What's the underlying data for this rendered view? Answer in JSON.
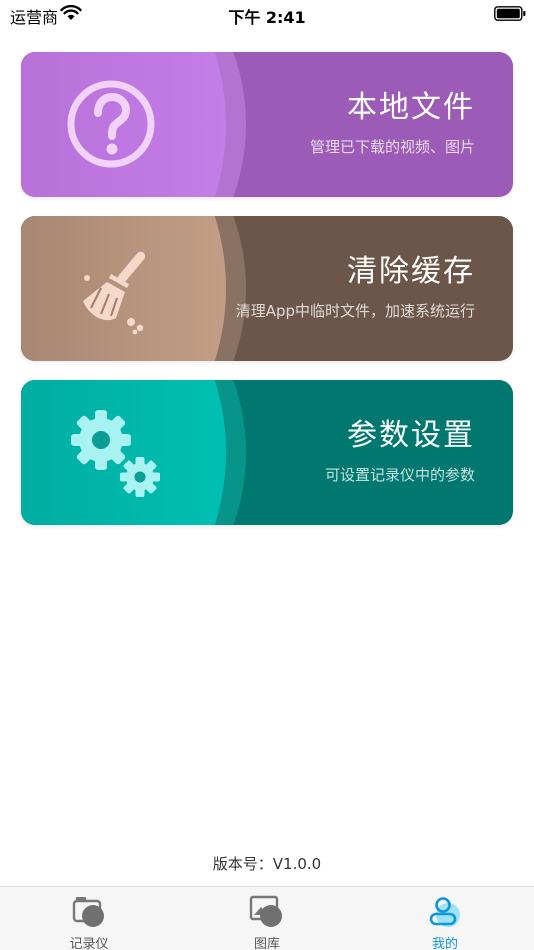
{
  "status_bar": {
    "carrier": "运营商",
    "time": "下午 2:41"
  },
  "cards": [
    {
      "title": "本地文件",
      "subtitle": "管理已下载的视频、图片",
      "icon": "question-circle-icon",
      "color": "#9c5bb6"
    },
    {
      "title": "清除缓存",
      "subtitle": "清理App中临时文件，加速系统运行",
      "icon": "broom-icon",
      "color": "#6b5649"
    },
    {
      "title": "参数设置",
      "subtitle": "可设置记录仪中的参数",
      "icon": "gears-icon",
      "color": "#00786f"
    }
  ],
  "version": "版本号：V1.0.0",
  "tab_bar": {
    "items": [
      {
        "label": "记录仪",
        "icon": "camera-icon",
        "active": false
      },
      {
        "label": "图库",
        "icon": "gallery-icon",
        "active": false
      },
      {
        "label": "我的",
        "icon": "user-icon",
        "active": true
      }
    ],
    "active_color": "#1296db"
  }
}
